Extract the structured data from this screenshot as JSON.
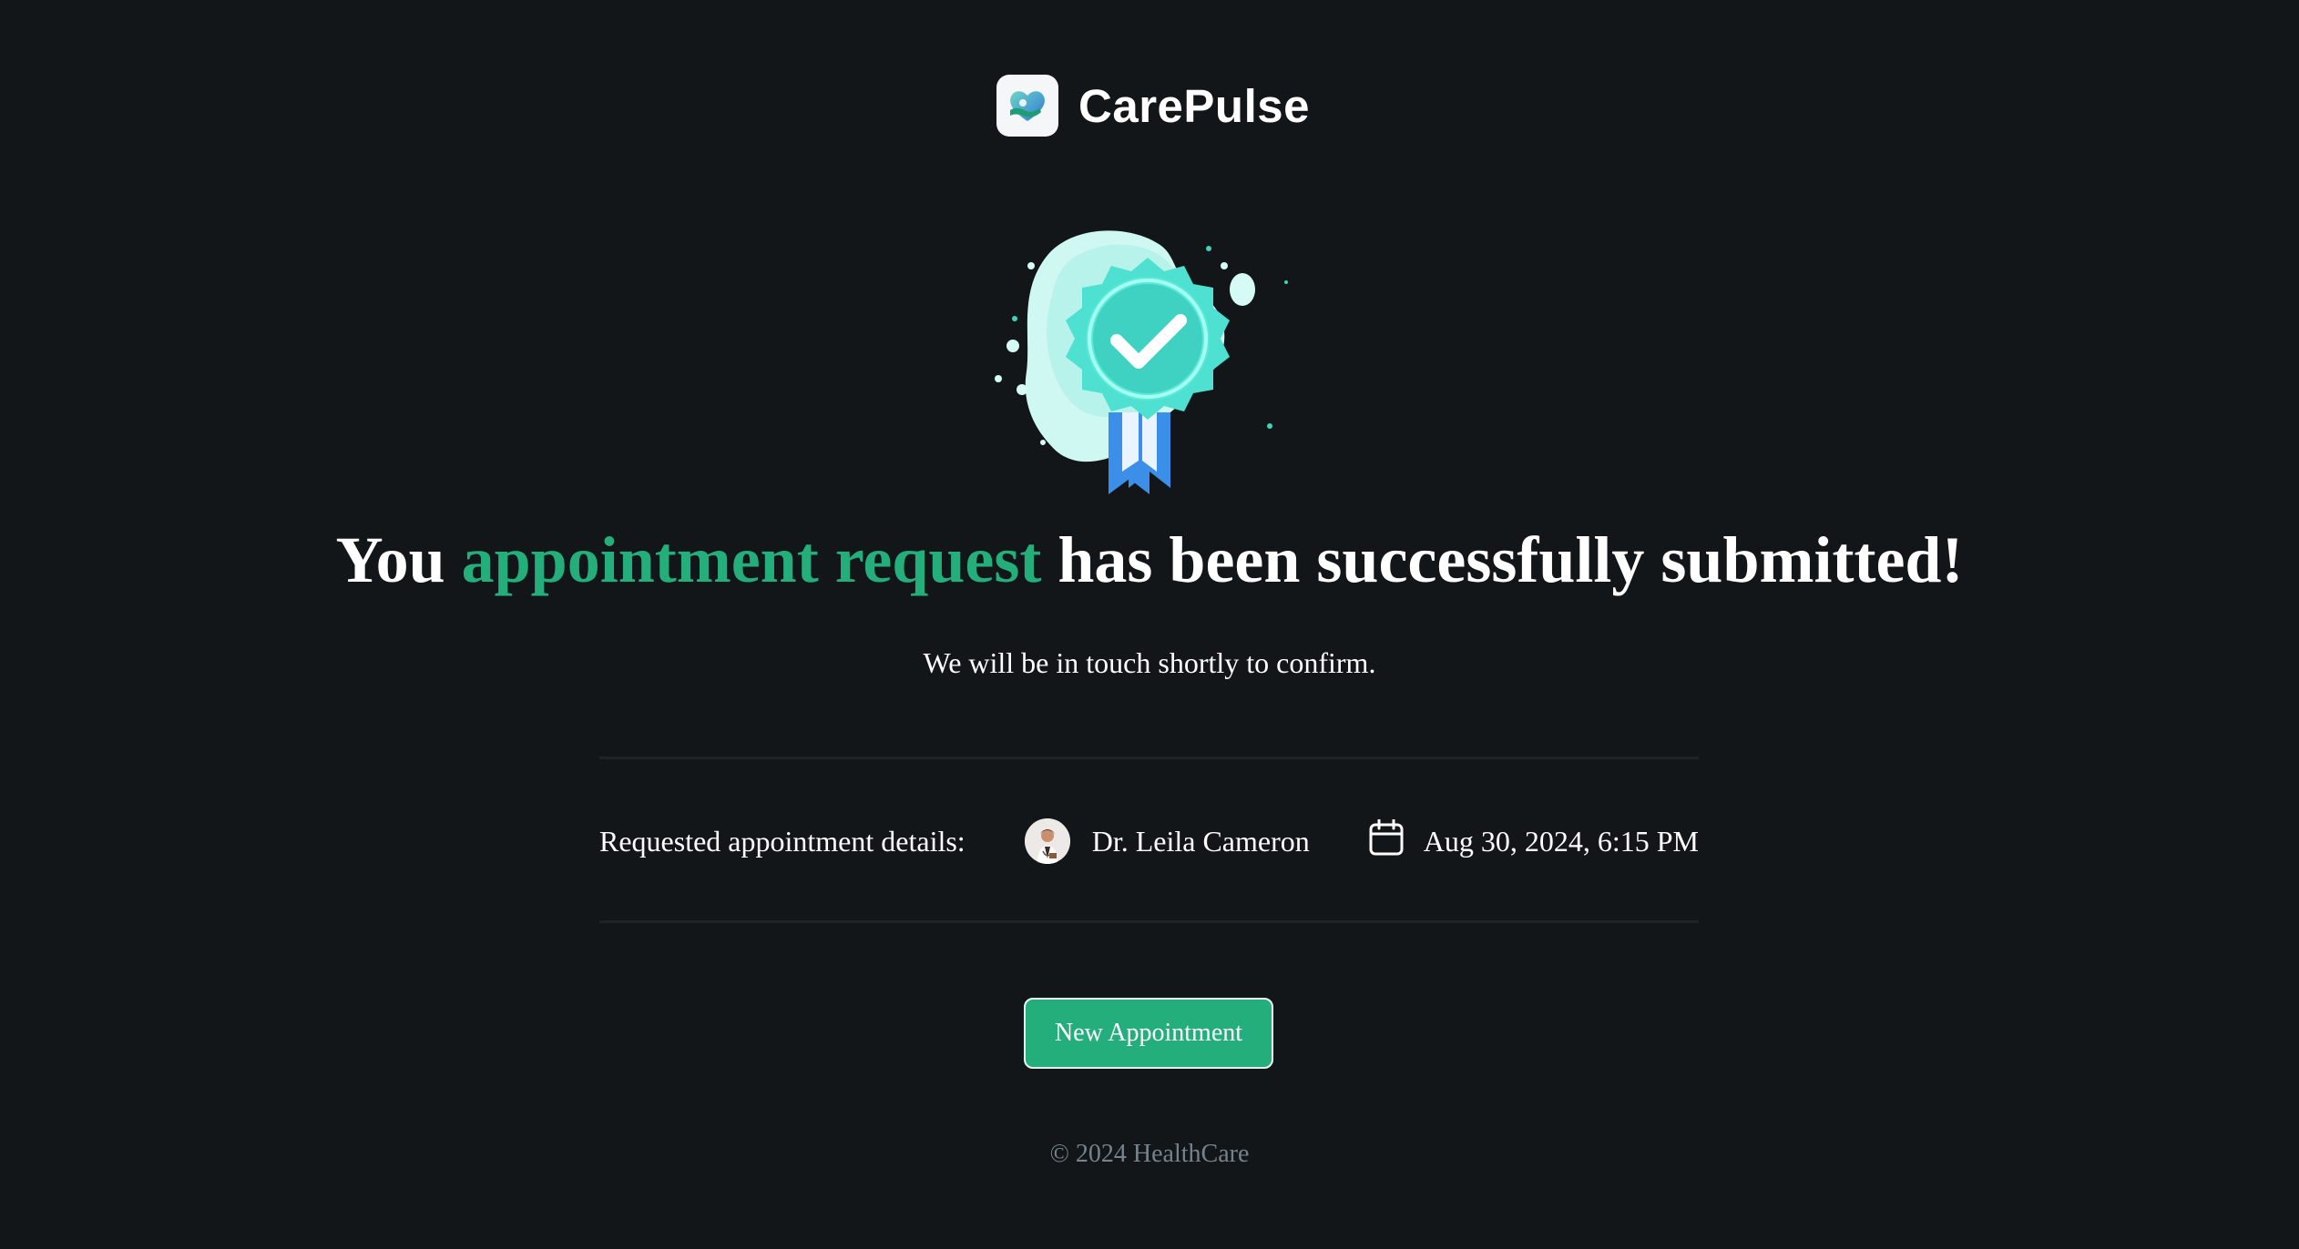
{
  "brand": {
    "name": "CarePulse",
    "logo_icon": "heart-hand-icon"
  },
  "success": {
    "badge_icon": "success-badge-icon",
    "headline_prefix": "You",
    "headline_accent": "appointment request",
    "headline_suffix": "has been successfully submitted!",
    "message": "We will be in touch shortly to confirm."
  },
  "details": {
    "label": "Requested appointment details:",
    "doctor_name": "Dr. Leila Cameron",
    "calendar_icon": "calendar-icon",
    "datetime": "Aug 30, 2024, 6:15 PM"
  },
  "actions": {
    "new_appointment_label": "New Appointment"
  },
  "footer": {
    "copyright": "© 2024 HealthCare"
  },
  "colors": {
    "background": "#131619",
    "accent": "#24ae7c",
    "divider": "#1e2328",
    "muted_text": "#76828d"
  }
}
